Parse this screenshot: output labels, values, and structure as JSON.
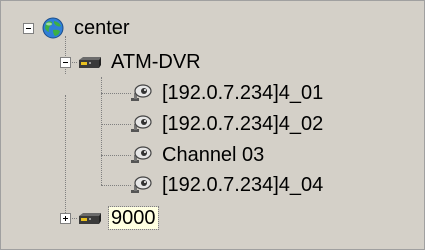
{
  "tree": {
    "root": {
      "label": "center",
      "icon": "globe-icon",
      "expanded": true
    },
    "children": [
      {
        "label": "ATM-DVR",
        "icon": "dvr-device-icon",
        "expanded": true,
        "channels": [
          {
            "label": "[192.0.7.234]4_01",
            "icon": "camera-icon"
          },
          {
            "label": "[192.0.7.234]4_02",
            "icon": "camera-icon"
          },
          {
            "label": "Channel 03",
            "icon": "camera-icon"
          },
          {
            "label": "[192.0.7.234]4_04",
            "icon": "camera-icon"
          }
        ]
      },
      {
        "label": "9000",
        "icon": "dvr-device-icon",
        "expanded": false,
        "selected": true
      }
    ]
  },
  "colors": {
    "background": "#d4d0c8",
    "connector": "#808080",
    "selection": "#ffffe1"
  }
}
